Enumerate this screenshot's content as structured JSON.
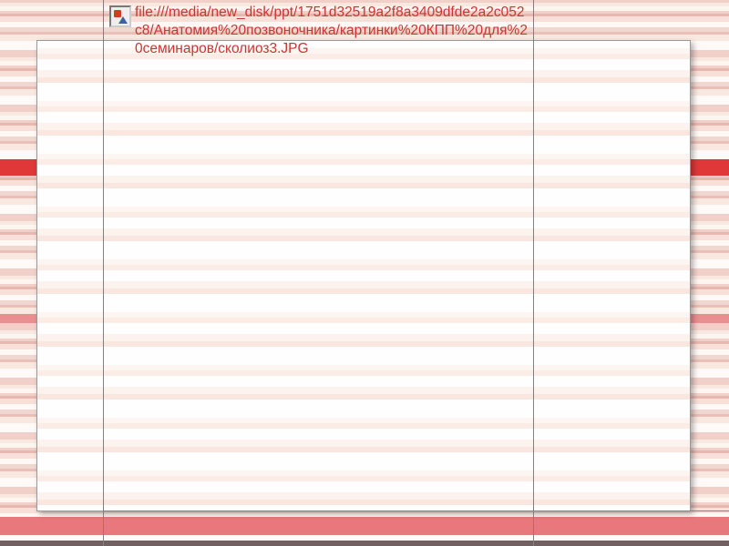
{
  "broken_link": {
    "url_text": "file:///media/new_disk/ppt/1751d32519a2f8a3409dfde2a2c052c8/Анатомия%20позвоночника/картинки%20КПП%20для%20семинаров/сколиоз3.JPG",
    "icon_name": "broken-image-icon"
  }
}
